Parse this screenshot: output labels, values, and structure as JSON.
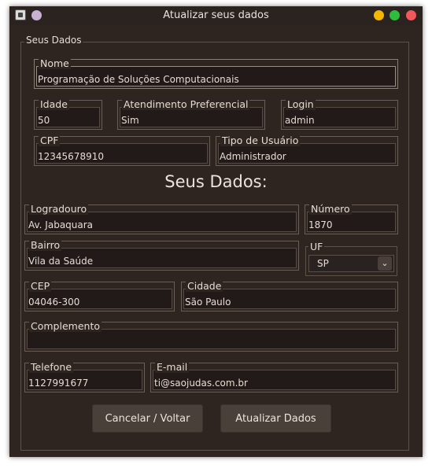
{
  "window": {
    "title": "Atualizar seus dados",
    "controls": {
      "minimize_color": "#f5b600",
      "maximize_color": "#2ebd3a",
      "close_color": "#f2575a",
      "menu_color": "#c9b1d4"
    }
  },
  "personal": {
    "legend": "Seus Dados",
    "nome": {
      "label": "Nome",
      "value": "Programação de Soluções Computacionais"
    },
    "idade": {
      "label": "Idade",
      "value": "50"
    },
    "atendimento": {
      "label": "Atendimento Preferencial",
      "value": "Sim"
    },
    "login": {
      "label": "Login",
      "value": "admin"
    },
    "cpf": {
      "label": "CPF",
      "value": "12345678910"
    },
    "tipo_usuario": {
      "label": "Tipo de Usuário",
      "value": "Administrador"
    }
  },
  "address": {
    "heading": "Seus Dados:",
    "logradouro": {
      "label": "Logradouro",
      "value": "Av. Jabaquara"
    },
    "numero": {
      "label": "Número",
      "value": "1870"
    },
    "bairro": {
      "label": "Bairro",
      "value": "Vila da Saúde"
    },
    "uf": {
      "label": "UF",
      "value": "SP"
    },
    "cep": {
      "label": "CEP",
      "value": "04046-300"
    },
    "cidade": {
      "label": "Cidade",
      "value": "São Paulo"
    },
    "complemento": {
      "label": "Complemento",
      "value": ""
    },
    "telefone": {
      "label": "Telefone",
      "value": "1127991677"
    },
    "email": {
      "label": "E-mail",
      "value": "ti@saojudas.com.br"
    }
  },
  "buttons": {
    "cancel": "Cancelar / Voltar",
    "update": "Atualizar Dados"
  }
}
